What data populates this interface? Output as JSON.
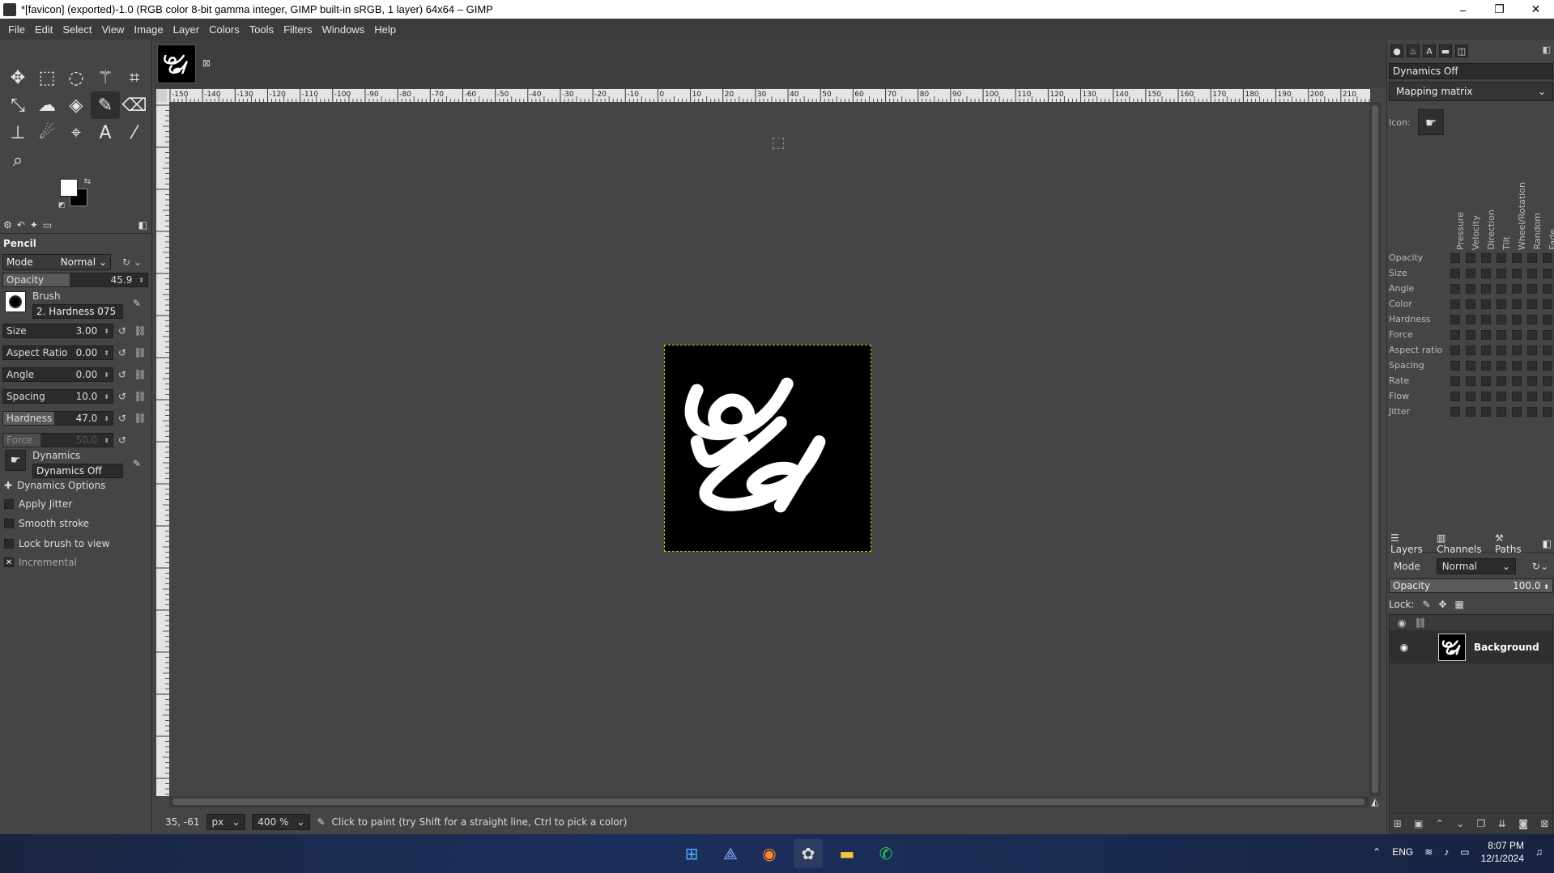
{
  "window": {
    "title": "*[favicon] (exported)-1.0 (RGB color 8-bit gamma integer, GIMP built-in sRGB, 1 layer) 64x64 – GIMP",
    "minimize": "–",
    "maximize": "❐",
    "close": "✕"
  },
  "menu": [
    "File",
    "Edit",
    "Select",
    "View",
    "Image",
    "Layer",
    "Colors",
    "Tools",
    "Filters",
    "Windows",
    "Help"
  ],
  "tool_options": {
    "tool_name": "Pencil",
    "mode_label": "Mode",
    "mode_value": "Normal",
    "opacity_label": "Opacity",
    "opacity_value": "45.9",
    "opacity_fraction": 0.459,
    "brush_label": "Brush",
    "brush_value": "2. Hardness 075",
    "size_label": "Size",
    "size_value": "3.00",
    "aspect_label": "Aspect Ratio",
    "aspect_value": "0.00",
    "angle_label": "Angle",
    "angle_value": "0.00",
    "spacing_label": "Spacing",
    "spacing_value": "10.0",
    "hardness_label": "Hardness",
    "hardness_value": "47.0",
    "force_label": "Force",
    "force_value": "50.0",
    "dynamics_label": "Dynamics",
    "dynamics_value": "Dynamics Off",
    "dynamics_options": "Dynamics Options",
    "apply_jitter": "Apply Jitter",
    "smooth_stroke": "Smooth stroke",
    "lock_brush": "Lock brush to view",
    "incremental": "Incremental",
    "incremental_checked": true
  },
  "dynamics_panel": {
    "title": "Dynamics Off",
    "mapping": "Mapping matrix",
    "icon_label": "Icon:",
    "columns": [
      "Pressure",
      "Velocity",
      "Direction",
      "Tilt",
      "Wheel/Rotation",
      "Random",
      "Fade"
    ],
    "rows": [
      "Opacity",
      "Size",
      "Angle",
      "Color",
      "Hardness",
      "Force",
      "Aspect ratio",
      "Spacing",
      "Rate",
      "Flow",
      "Jitter"
    ]
  },
  "layers_panel": {
    "tabs": [
      "Layers",
      "Channels",
      "Paths"
    ],
    "mode_label": "Mode",
    "mode_value": "Normal",
    "opacity_label": "Opacity",
    "opacity_value": "100.0",
    "lock_label": "Lock:",
    "layer_name": "Background"
  },
  "status": {
    "coords": "35, -61",
    "unit": "px",
    "zoom": "400 %",
    "message": "Click to paint (try Shift for a straight line, Ctrl to pick a color)"
  },
  "ruler_labels": [
    "-150",
    "-140",
    "-130",
    "-120",
    "-110",
    "-100",
    "-90",
    "-80",
    "-70",
    "-60",
    "-50",
    "-40",
    "-30",
    "-20",
    "-10",
    "0",
    "10",
    "20",
    "30",
    "40",
    "50",
    "60",
    "70",
    "80",
    "90",
    "100",
    "110",
    "120",
    "130",
    "140",
    "150",
    "160",
    "170",
    "180",
    "190",
    "200",
    "210"
  ],
  "taskbar": {
    "lang": "ENG",
    "time": "8:07 PM",
    "date": "12/1/2024"
  }
}
